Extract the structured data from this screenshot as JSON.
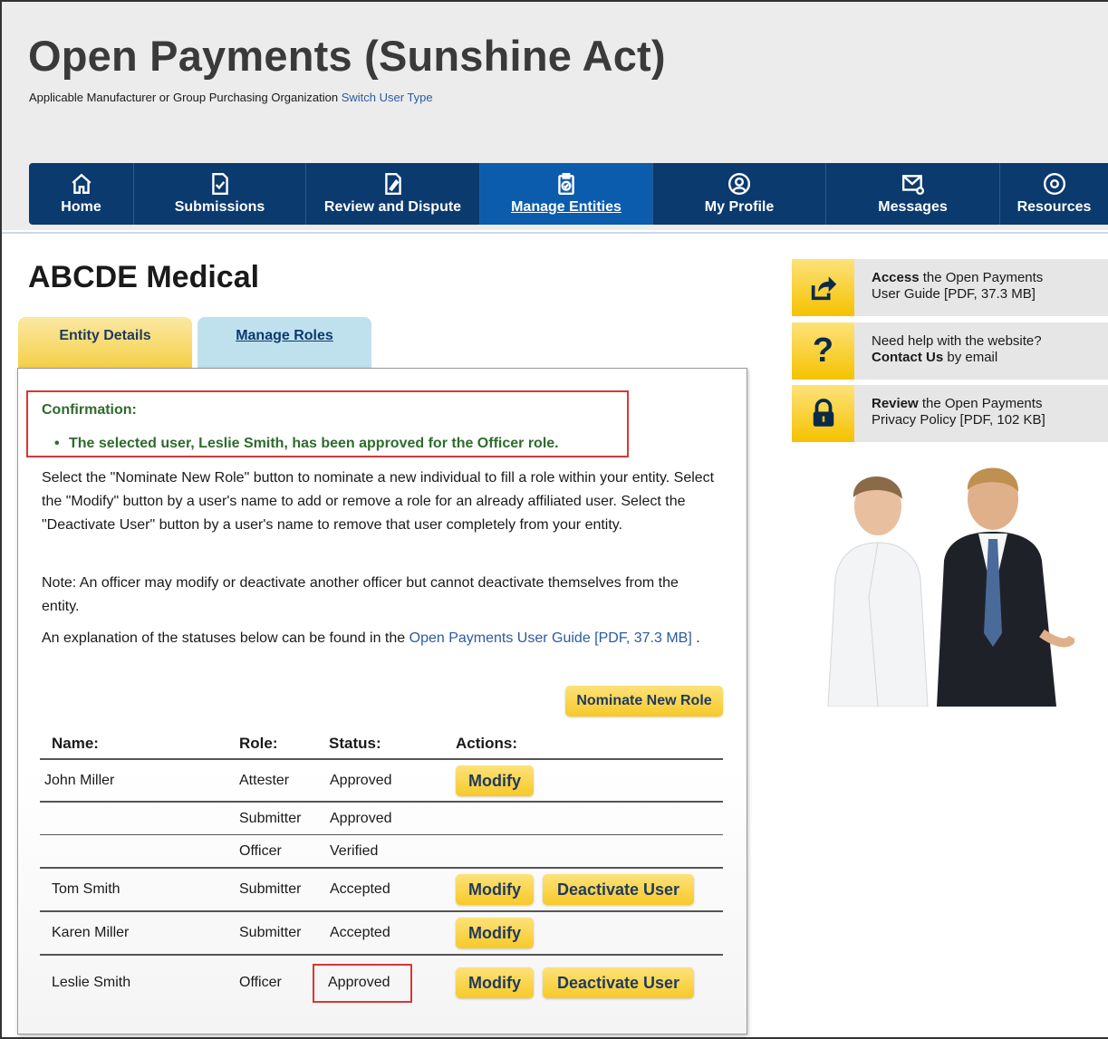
{
  "header": {
    "title": "Open Payments (Sunshine Act)",
    "user_type": "Applicable Manufacturer or Group Purchasing Organization",
    "switch_link": "Switch User Type"
  },
  "nav": {
    "items": [
      {
        "label": "Home",
        "icon": "home-icon"
      },
      {
        "label": "Submissions",
        "icon": "document-check-icon"
      },
      {
        "label": "Review and Dispute",
        "icon": "document-edit-icon"
      },
      {
        "label": "Manage Entities",
        "icon": "clipboard-check-icon",
        "active": true
      },
      {
        "label": "My Profile",
        "icon": "user-circle-icon"
      },
      {
        "label": "Messages",
        "icon": "mail-icon"
      },
      {
        "label": "Resources",
        "icon": "gear-icon"
      }
    ]
  },
  "entity": {
    "name": "ABCDE Medical"
  },
  "tabs": {
    "entity_details": "Entity Details",
    "manage_roles": "Manage Roles"
  },
  "confirmation": {
    "title": "Confirmation:",
    "message": "The selected user, Leslie Smith, has been approved for the Officer role."
  },
  "instructions": {
    "p1": "Select the \"Nominate New Role\" button to nominate a new individual to fill a role within your entity. Select the \"Modify\" button by a user's name to add or remove a role for an already affiliated user. Select the \"Deactivate User\" button by a user's name to remove that user completely from your entity.",
    "p2": "Note: An officer may modify or deactivate another officer but cannot deactivate themselves from the entity.",
    "p3_prefix": "An explanation of the statuses below can be found in the ",
    "p3_link": "Open Payments User Guide [PDF, 37.3 MB]",
    "p3_suffix": " ."
  },
  "buttons": {
    "nominate": "Nominate New Role",
    "modify": "Modify",
    "deactivate": "Deactivate User"
  },
  "table": {
    "headers": [
      "Name:",
      "Role:",
      "Status:",
      "Actions:"
    ],
    "rows": [
      {
        "name": "John Miller",
        "role": "Attester",
        "status": "Approved"
      },
      {
        "name": "",
        "role": "Submitter",
        "status": "Approved"
      },
      {
        "name": "",
        "role": "Officer",
        "status": "Verified"
      },
      {
        "name": "Tom Smith",
        "role": "Submitter",
        "status": "Accepted"
      },
      {
        "name": "Karen Miller",
        "role": "Submitter",
        "status": "Accepted"
      },
      {
        "name": "Leslie Smith",
        "role": "Officer",
        "status": "Approved"
      }
    ]
  },
  "sidebar": {
    "items": [
      {
        "icon": "share-icon",
        "bold": "Access",
        "rest1": " the Open Payments",
        "line2": "User Guide [PDF, 37.3 MB]"
      },
      {
        "icon": "question-icon",
        "line1": "Need help with the website?",
        "bold": "Contact Us",
        "rest2": " by email"
      },
      {
        "icon": "lock-icon",
        "bold": "Review",
        "rest1": " the Open Payments",
        "line2": "Privacy Policy [PDF, 102 KB]"
      }
    ]
  }
}
